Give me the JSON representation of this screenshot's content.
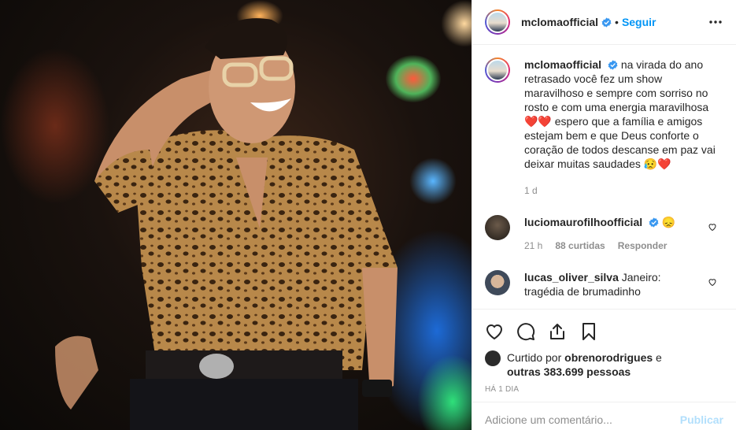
{
  "post": {
    "username": "mcloma official",
    "follow_label": "Seguir",
    "separator": "•"
  },
  "caption": {
    "username": "mclomaofficial",
    "text": "na virada do ano retrasado você fez um show maravilhoso e sempre com sorriso no rosto e com uma energia maravilhosa ❤️❤️ espero que a família e amigos estejam bem e que Deus conforte o coração de todos descanse em paz vai deixar muitas saudades 😥❤️",
    "time": "1 d"
  },
  "comments": [
    {
      "username": "luciomaurofilhoofficial",
      "text": "😞",
      "time": "21 h",
      "likes": "88 curtidas",
      "reply": "Responder",
      "verified": true
    },
    {
      "username": "lucas_oliver_silva",
      "text": "Janeiro: tragédia de brumadinho",
      "verified": false
    }
  ],
  "likes": {
    "prefix": "Curtido por ",
    "user": "obrenorodrigues",
    "middle": " e",
    "others": "outras 383.699 pessoas"
  },
  "timeago": "HÁ 1 DIA",
  "add_comment": {
    "placeholder": "Adicione um comentário...",
    "post_label": "Publicar"
  },
  "colors": {
    "accent": "#0095f6",
    "muted": "#8e8e8e",
    "heart": "#ed4956"
  },
  "icons": [
    "ellipsis-icon",
    "verified-icon",
    "heart-icon",
    "comment-icon",
    "share-icon",
    "bookmark-icon"
  ]
}
